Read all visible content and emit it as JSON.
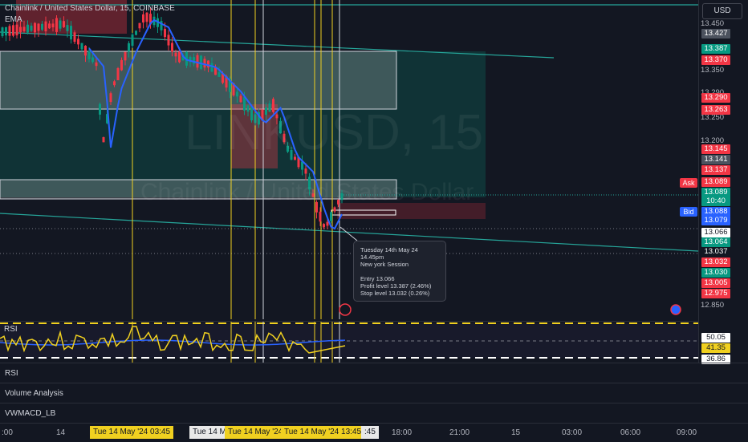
{
  "header": {
    "title": "Chainlink / United States Dollar, 15, COINBASE",
    "indicator": "EMA"
  },
  "watermark": {
    "symbol": "LINKUSD, 15",
    "name": "Chainlink / United States Dollar"
  },
  "currency_button": "USD",
  "price_axis": {
    "labels": [
      "13.450",
      "13.350",
      "13.290",
      "13.250",
      "13.200",
      "12.850"
    ],
    "tags": [
      {
        "text": "13.427",
        "color": "#4c525e"
      },
      {
        "text": "13.387",
        "color": "#089981"
      },
      {
        "text": "13.370",
        "color": "#f23645"
      },
      {
        "text": "13.290",
        "color": "#f23645"
      },
      {
        "text": "13.263",
        "color": "#f23645"
      },
      {
        "text": "13.145",
        "color": "#f23645"
      },
      {
        "text": "13.141",
        "color": "#4c525e"
      },
      {
        "text": "13.137",
        "color": "#f23645"
      },
      {
        "text": "13.089",
        "color": "#f23645"
      },
      {
        "text": "13.089",
        "color": "#089981"
      },
      {
        "text": "10:40",
        "color": "#089981"
      },
      {
        "text": "13.088",
        "color": "#2962ff"
      },
      {
        "text": "13.079",
        "color": "#2962ff"
      },
      {
        "text": "13.066",
        "color": "#ffffff"
      },
      {
        "text": "13.064",
        "color": "#089981"
      },
      {
        "text": "13.037",
        "color": "#131722"
      },
      {
        "text": "13.032",
        "color": "#f23645"
      },
      {
        "text": "13.030",
        "color": "#089981"
      },
      {
        "text": "13.005",
        "color": "#f23645"
      },
      {
        "text": "12.975",
        "color": "#f23645"
      }
    ],
    "ask_label": "Ask",
    "bid_label": "Bid"
  },
  "rsi": {
    "label": "RSI",
    "tags": [
      {
        "text": "50.05",
        "color": "#ffffff"
      },
      {
        "text": "41.35",
        "color": "#f0d020"
      },
      {
        "text": "36.86",
        "color": "#ffffff"
      }
    ]
  },
  "tooltip": {
    "date": "Tuesday 14th May 24",
    "time": "14.45pm",
    "session": "New york Session",
    "entry": "Entry 13.066",
    "profit": "Profit level 13.387 (2.46%)",
    "stop": "Stop level 13.032 (0.26%)"
  },
  "panes": {
    "rsi": "RSI",
    "volume": "Volume Analysis",
    "vwmacd": "VWMACD_LB"
  },
  "time_axis": {
    "labels": [
      ":00",
      "14",
      "18:00",
      "21:00",
      "15",
      "03:00",
      "06:00",
      "09:00"
    ],
    "highlights": [
      "Tue 14 May '24  03:45",
      "Tue 14 M",
      "Tue 14 May '24",
      "Tue 14 May '24  13:45",
      ":45"
    ]
  },
  "colors": {
    "up": "#089981",
    "down": "#f23645",
    "ema": "#2962ff",
    "vline": "#f0d020",
    "rsi": "#f0d020"
  }
}
